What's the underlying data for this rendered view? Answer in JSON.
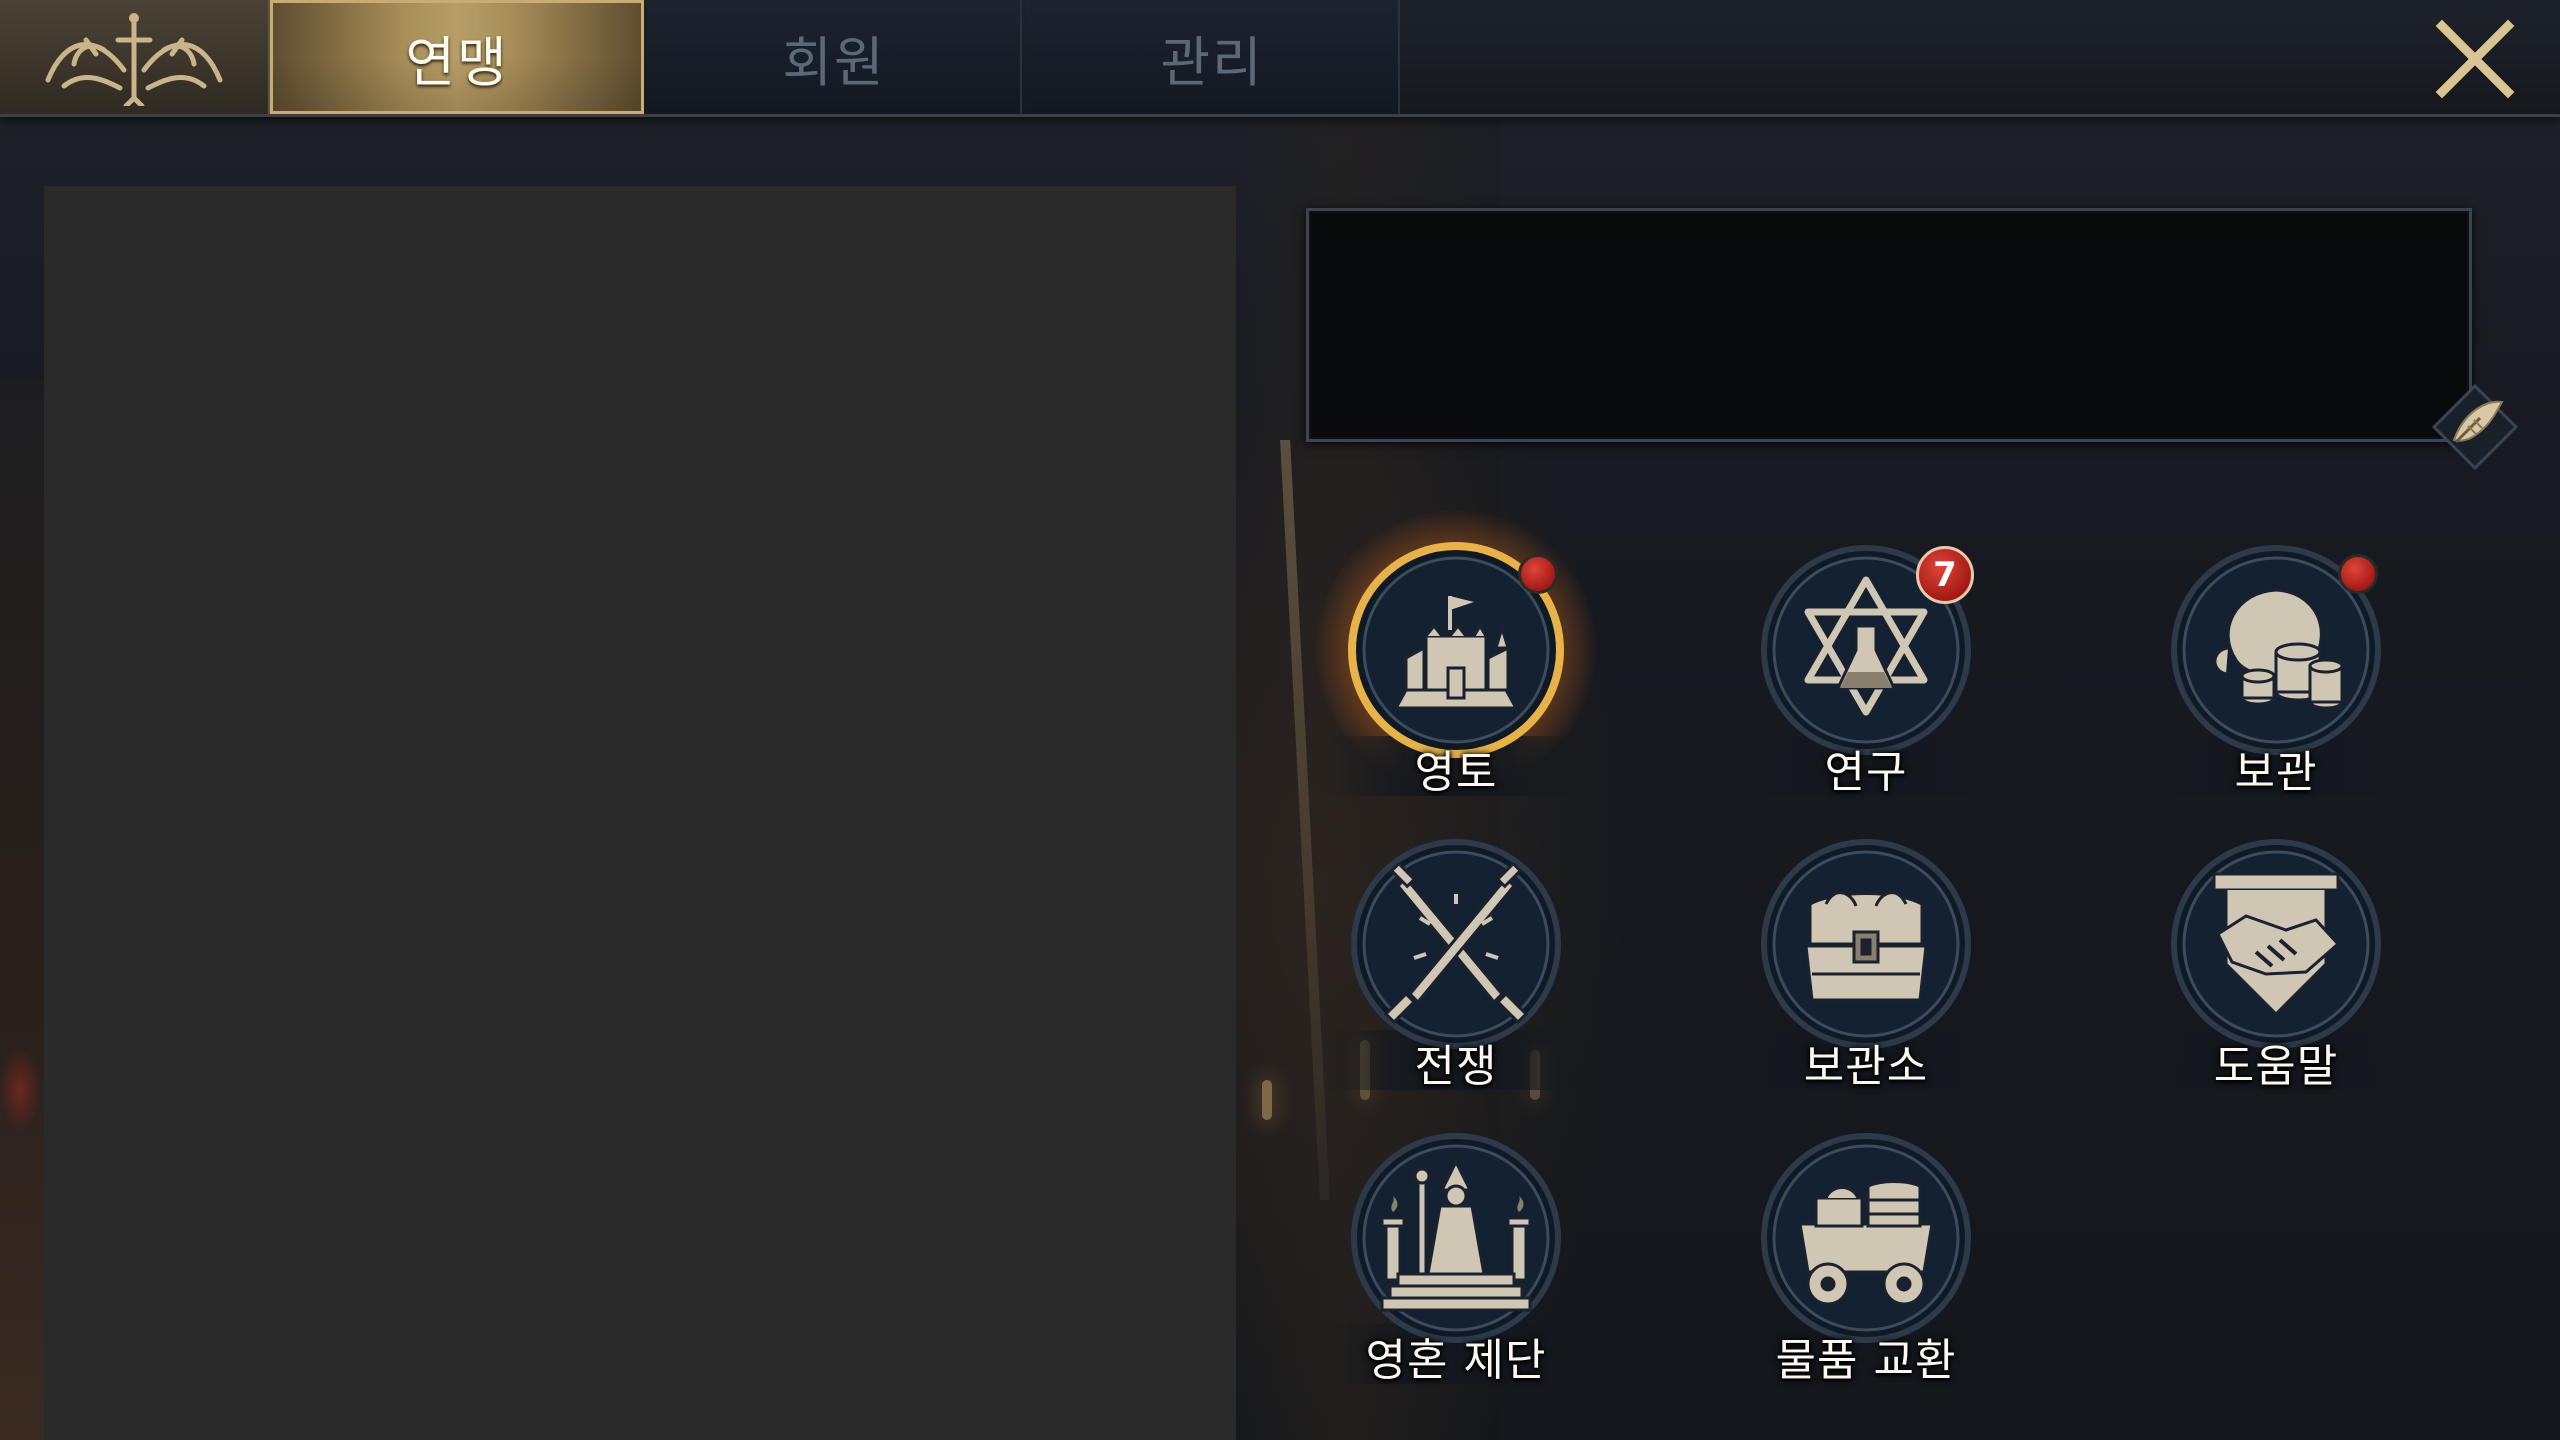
{
  "tabs": [
    {
      "label": "연맹",
      "active": true
    },
    {
      "label": "회원",
      "active": false
    },
    {
      "label": "관리",
      "active": false
    }
  ],
  "notice": {
    "text": ""
  },
  "menu": [
    {
      "label": "영토",
      "icon": "castle-icon",
      "indicator": "dot",
      "highlighted": true
    },
    {
      "label": "연구",
      "icon": "research-flask-icon",
      "indicator": "badge",
      "badge_count": "7"
    },
    {
      "label": "보관",
      "icon": "treasure-sack-icon",
      "indicator": "dot"
    },
    {
      "label": "전쟁",
      "icon": "crossed-swords-icon"
    },
    {
      "label": "보관소",
      "icon": "treasure-chest-icon"
    },
    {
      "label": "도움말",
      "icon": "handshake-icon"
    },
    {
      "label": "영혼 제단",
      "icon": "wizard-altar-icon"
    },
    {
      "label": "물품 교환",
      "icon": "cargo-cart-icon"
    }
  ],
  "colors": {
    "accent_gold": "#b79d66",
    "inactive_tab_text": "#5d6876",
    "notification_red": "#c0241b",
    "left_panel": "#2a2a2a"
  }
}
